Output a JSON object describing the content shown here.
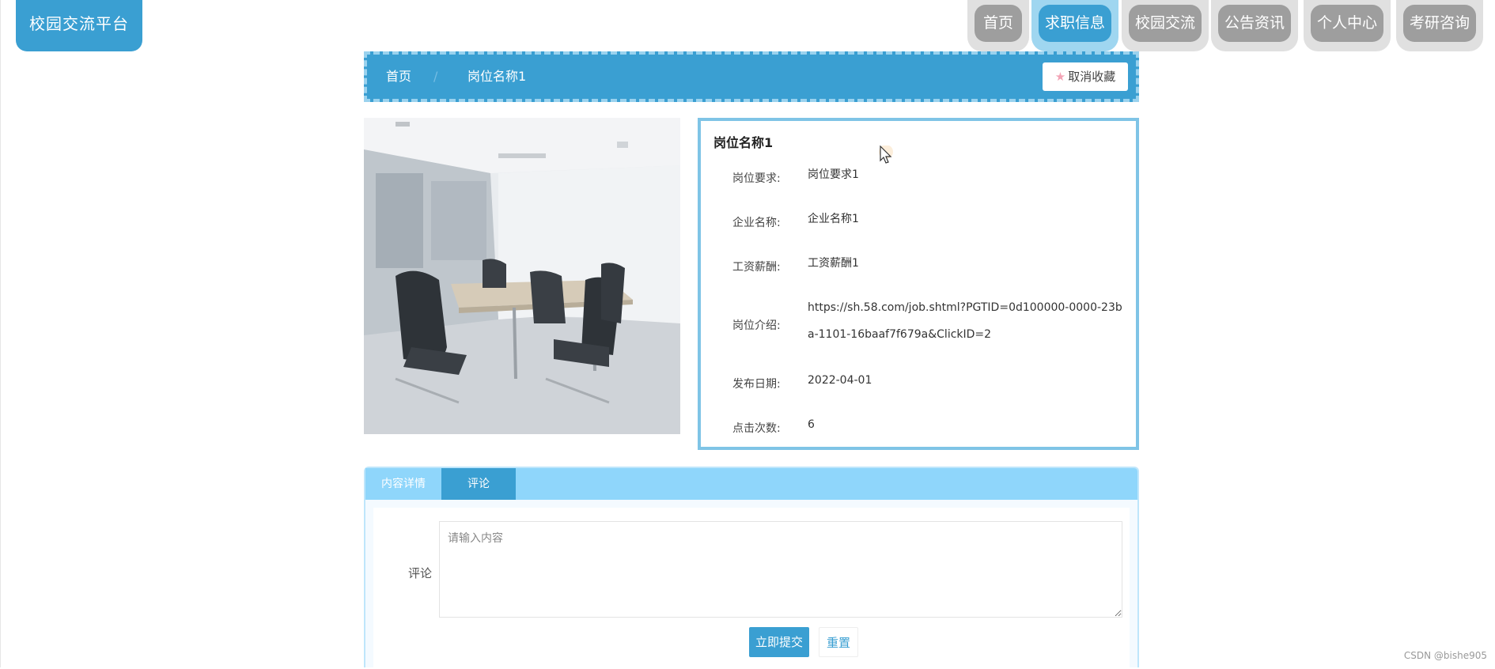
{
  "app": {
    "title": "校园交流平台"
  },
  "nav": {
    "items": [
      {
        "label": "首页",
        "active": false
      },
      {
        "label": "求职信息",
        "active": true
      },
      {
        "label": "校园交流",
        "active": false
      },
      {
        "label": "公告资讯",
        "active": false
      },
      {
        "label": "个人中心",
        "active": false
      },
      {
        "label": "考研咨询",
        "active": false
      }
    ]
  },
  "breadcrumb": {
    "home": "首页",
    "current": "岗位名称1"
  },
  "favorite": {
    "label": "取消收藏",
    "icon": "star-icon"
  },
  "job": {
    "title": "岗位名称1",
    "fields": [
      {
        "label": "岗位要求:",
        "value": "岗位要求1"
      },
      {
        "label": "企业名称:",
        "value": "企业名称1"
      },
      {
        "label": "工资薪酬:",
        "value": "工资薪酬1"
      },
      {
        "label": "岗位介绍:",
        "value": "https://sh.58.com/job.shtml?PGTID=0d100000-0000-23ba-1101-16baaf7f679a&ClickID=2"
      },
      {
        "label": "发布日期:",
        "value": "2022-04-01"
      },
      {
        "label": "点击次数:",
        "value": "6"
      }
    ]
  },
  "tabs": {
    "details": "内容详情",
    "comments": "评论"
  },
  "comment_form": {
    "label": "评论",
    "placeholder": "请输入内容",
    "submit": "立即提交",
    "reset": "重置"
  },
  "watermark": "CSDN @bishe905",
  "colors": {
    "primary": "#3a9fd2",
    "nav_inactive": "#9e9e9e",
    "tab_bar": "#8fd6fb"
  }
}
